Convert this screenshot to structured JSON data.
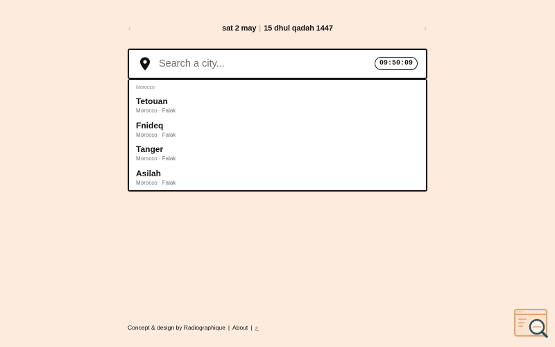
{
  "datebar": {
    "prev_icon": "chevron-left-icon",
    "next_icon": "chevron-right-icon",
    "gregorian": "sat 2 may",
    "separator": "|",
    "hijri": "15 dhul qadah 1447"
  },
  "search": {
    "icon": "location-pin-icon",
    "placeholder": "Search a city...",
    "value": "",
    "clock": "09:50:09"
  },
  "results": {
    "group_label": "Morocco",
    "items": [
      {
        "name": "Tetouan",
        "meta": "Morocco · Falak"
      },
      {
        "name": "Fnideq",
        "meta": "Morocco · Falak"
      },
      {
        "name": "Tanger",
        "meta": "Morocco · Falak"
      },
      {
        "name": "Asilah",
        "meta": "Morocco · Falak"
      }
    ]
  },
  "footer": {
    "credit": "Concept & design by Radiographique",
    "sep1": "|",
    "about": "About",
    "sep2": "|",
    "arabic": "ع"
  },
  "colors": {
    "background": "#fdebdd",
    "badge_accent": "#e8a06b",
    "badge_dark": "#2f4f5a"
  },
  "badge": {
    "icon": "search-window-icon"
  }
}
